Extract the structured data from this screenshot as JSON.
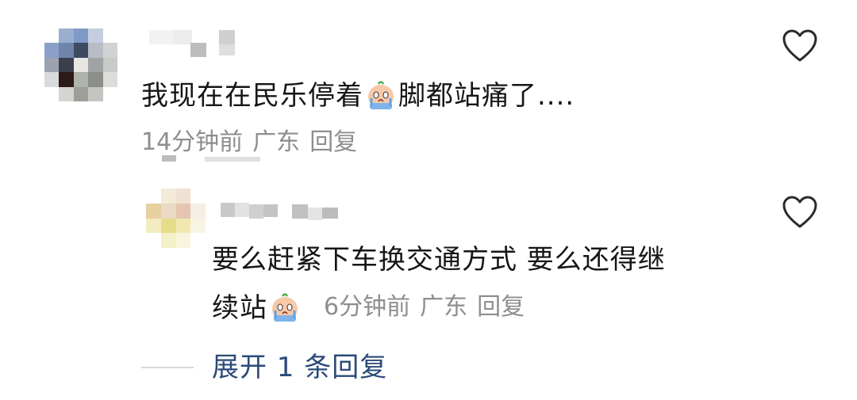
{
  "comments": [
    {
      "text_before": "我现在在民乐停着",
      "emoji": "crying-face-emoji",
      "text_after": "脚都站痛了....",
      "time": "14分钟前",
      "location": "广东",
      "reply_label": "回复"
    }
  ],
  "replies": [
    {
      "line1": "要么赶紧下车换交通方式 要么还得继",
      "line2": "续站",
      "emoji": "crying-face-emoji",
      "time": "6分钟前",
      "location": "广东",
      "reply_label": "回复"
    }
  ],
  "expand_label": "展开 1 条回复",
  "icons": {
    "like": "heart-outline-icon",
    "emoji": "crying-face-emoji"
  },
  "colors": {
    "text": "#161616",
    "meta": "#8e8e8e",
    "link": "#2b4a78"
  }
}
